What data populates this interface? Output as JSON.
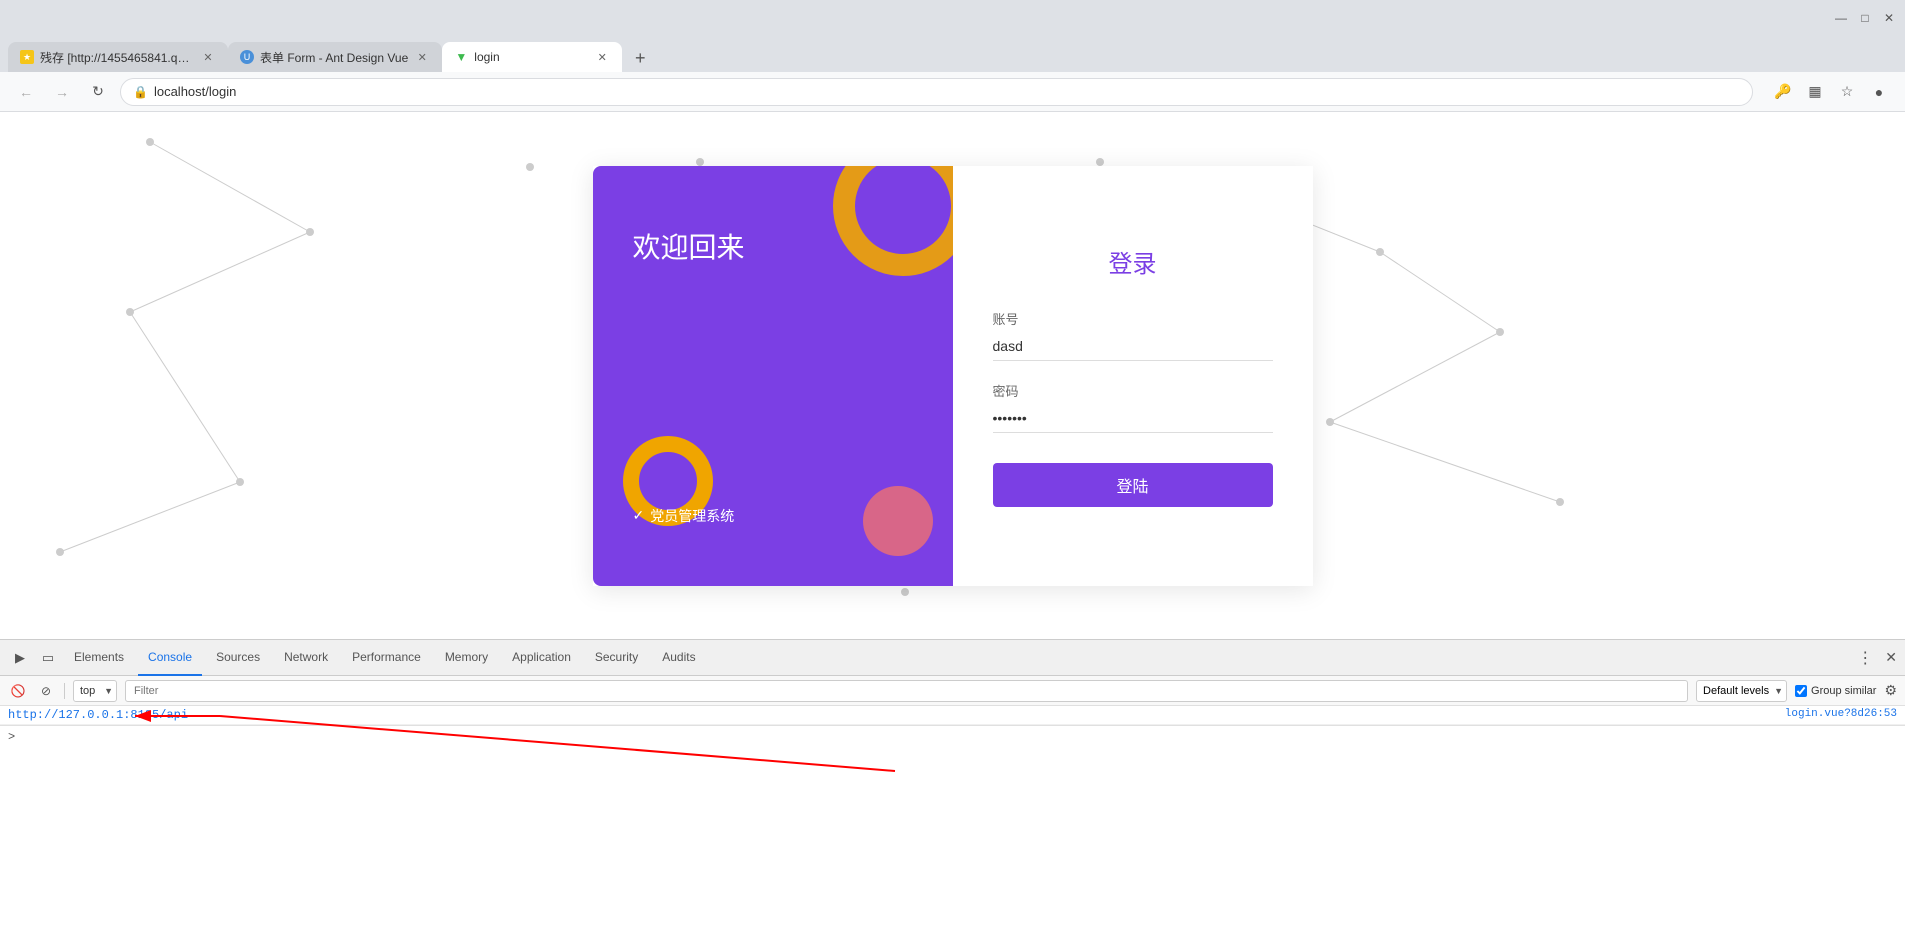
{
  "browser": {
    "tabs": [
      {
        "id": "tab1",
        "favicon_color": "#f5c518",
        "title": "残存 [http://1455465841.qzon...",
        "active": false
      },
      {
        "id": "tab2",
        "favicon_color": "#4A90D9",
        "title": "表单 Form - Ant Design Vue",
        "active": false
      },
      {
        "id": "tab3",
        "favicon_color": "#3dba4e",
        "title": "login",
        "active": true
      }
    ],
    "url": "localhost/login",
    "nav": {
      "back": "←",
      "forward": "→",
      "reload": "↻"
    }
  },
  "login_page": {
    "left": {
      "welcome": "欢迎回来",
      "system_icon": "✓",
      "system_name": "党员管理系统"
    },
    "right": {
      "title": "登录",
      "account_label": "账号",
      "account_value": "dasd",
      "password_label": "密码",
      "password_value": "·······",
      "login_btn": "登陆"
    }
  },
  "devtools": {
    "tabs": [
      {
        "label": "Elements",
        "active": false
      },
      {
        "label": "Console",
        "active": true
      },
      {
        "label": "Sources",
        "active": false
      },
      {
        "label": "Network",
        "active": false
      },
      {
        "label": "Performance",
        "active": false
      },
      {
        "label": "Memory",
        "active": false
      },
      {
        "label": "Application",
        "active": false
      },
      {
        "label": "Security",
        "active": false
      },
      {
        "label": "Audits",
        "active": false
      }
    ],
    "console": {
      "context": "top",
      "filter_placeholder": "Filter",
      "levels": "Default levels",
      "group_similar_label": "Group similar",
      "group_similar_checked": true,
      "entry_url": "http://127.0.0.1:8185/api",
      "entry_source": "login.vue?8d26:53",
      "prompt_symbol": ">"
    }
  },
  "colors": {
    "purple": "#7b3fe4",
    "gold": "#f0a500",
    "pink": "#f07070",
    "blue": "#1a73e8",
    "devtools_bg": "#f8f8f8"
  }
}
